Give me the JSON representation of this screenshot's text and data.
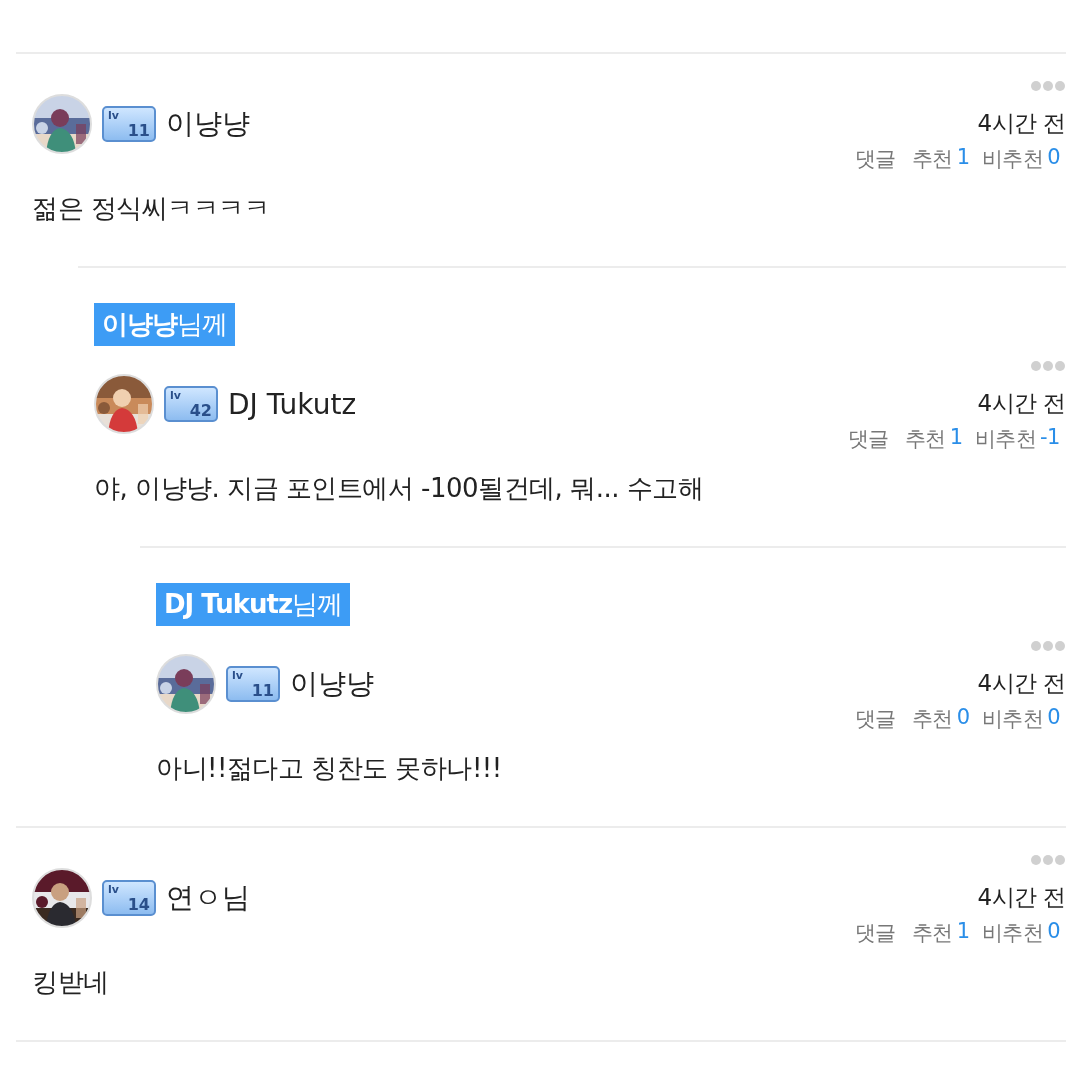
{
  "comments": [
    {
      "author": "이냥냥",
      "level_prefix": "lv",
      "level": "11",
      "time": "4시간 전",
      "reply_label": "댓글",
      "up_label": "추천",
      "up": "1",
      "down_label": "비추천",
      "down": "0",
      "text": "젊은 정식씨ㅋㅋㅋㅋ",
      "children": [
        {
          "reply_to": "**이냥냥**님께",
          "author": "DJ Tukutz",
          "level_prefix": "lv",
          "level": "42",
          "time": "4시간 전",
          "reply_label": "댓글",
          "up_label": "추천",
          "up": "1",
          "down_label": "비추천",
          "down": "-1",
          "text": "야, 이냥냥. 지금 포인트에서 -100될건데, 뭐... 수고해",
          "children": [
            {
              "reply_to": "**DJ Tukutz**님께",
              "author": "이냥냥",
              "level_prefix": "lv",
              "level": "11",
              "time": "4시간 전",
              "reply_label": "댓글",
              "up_label": "추천",
              "up": "0",
              "down_label": "비추천",
              "down": "0",
              "text": "아니!!젊다고 칭찬도 못하나!!!"
            }
          ]
        }
      ]
    },
    {
      "author": "연ㅇ님",
      "level_prefix": "lv",
      "level": "14",
      "time": "4시간 전",
      "reply_label": "댓글",
      "up_label": "추천",
      "up": "1",
      "down_label": "비추천",
      "down": "0",
      "text": "킹받네"
    }
  ]
}
